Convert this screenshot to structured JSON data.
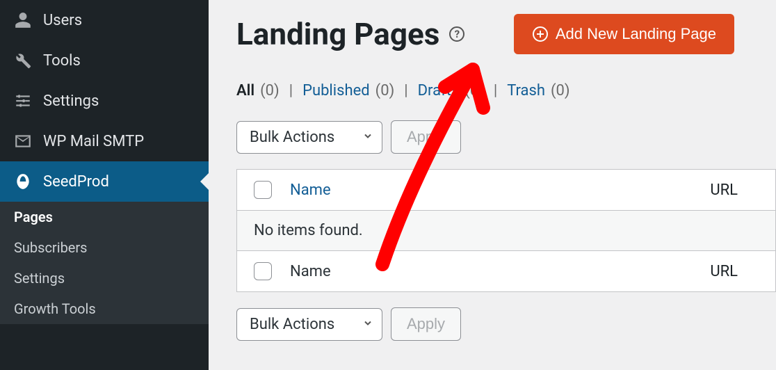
{
  "sidebar": {
    "items": [
      {
        "label": "Users",
        "icon": "user-icon"
      },
      {
        "label": "Tools",
        "icon": "wrench-icon"
      },
      {
        "label": "Settings",
        "icon": "sliders-icon"
      },
      {
        "label": "WP Mail SMTP",
        "icon": "mail-icon"
      },
      {
        "label": "SeedProd",
        "icon": "seedprod-icon"
      }
    ],
    "sub": [
      {
        "label": "Pages",
        "current": true
      },
      {
        "label": "Subscribers",
        "current": false
      },
      {
        "label": "Settings",
        "current": false
      },
      {
        "label": "Growth Tools",
        "current": false
      }
    ]
  },
  "header": {
    "title": "Landing Pages",
    "add_button": "Add New Landing Page"
  },
  "filters": [
    {
      "label": "All",
      "count": "(0)",
      "current": true
    },
    {
      "label": "Published",
      "count": "(0)",
      "current": false
    },
    {
      "label": "Drafts",
      "count": "(0)",
      "current": false
    },
    {
      "label": "Trash",
      "count": "(0)",
      "current": false
    }
  ],
  "bulk": {
    "select": "Bulk Actions",
    "apply": "Apply"
  },
  "table": {
    "col_name": "Name",
    "col_url": "URL",
    "empty": "No items found."
  },
  "colors": {
    "accent": "#dd4a1f",
    "sidebar_active": "#0c5c88",
    "link": "#135e96"
  }
}
